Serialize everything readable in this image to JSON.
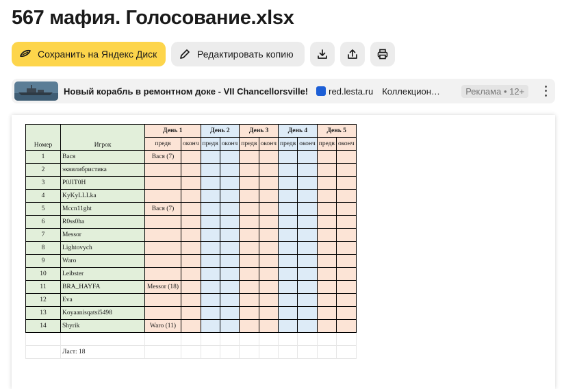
{
  "title": "567 мафия. Голосование.xlsx",
  "toolbar": {
    "save_label": "Сохранить на Яндекс Диск",
    "edit_label": "Редактировать копию",
    "download_icon": "download-icon",
    "share_icon": "share-icon",
    "print_icon": "print-icon"
  },
  "ad": {
    "title": "Новый корабль в ремонтном доке - VII Chancellorsville!",
    "domain": "red.lesta.ru",
    "text": "Коллекцион…",
    "badge": "Реклама • 12+"
  },
  "colors": {
    "accent": "#fdd54b",
    "green": "#e2efda",
    "orange": "#fce4d6",
    "blue": "#ddebf7"
  },
  "sheet": {
    "header": {
      "number": "Номер",
      "player": "Игрок",
      "days": [
        "День 1",
        "День 2",
        "День 3",
        "День 4",
        "День 5"
      ],
      "pre": "предв",
      "final": "оконч"
    },
    "rows": [
      {
        "num": "1",
        "player": "Вася",
        "vote": "Вася (7)"
      },
      {
        "num": "2",
        "player": "эквилибристика",
        "vote": ""
      },
      {
        "num": "3",
        "player": "P0JIT0H",
        "vote": ""
      },
      {
        "num": "4",
        "player": "KyKyLLLka",
        "vote": ""
      },
      {
        "num": "5",
        "player": "Mccn11ght",
        "vote": "Вася (7)"
      },
      {
        "num": "6",
        "player": "R0ss0ha",
        "vote": ""
      },
      {
        "num": "7",
        "player": "Messor",
        "vote": ""
      },
      {
        "num": "8",
        "player": "Lightovych",
        "vote": ""
      },
      {
        "num": "9",
        "player": "Waro",
        "vote": ""
      },
      {
        "num": "10",
        "player": "Leibster",
        "vote": ""
      },
      {
        "num": "11",
        "player": "BRA_HAYFA",
        "vote": "Messor (18)"
      },
      {
        "num": "12",
        "player": "Eva",
        "vote": ""
      },
      {
        "num": "13",
        "player": "Koyaanisqatsi5498",
        "vote": ""
      },
      {
        "num": "14",
        "player": "Shyrik",
        "vote": "Waro (11)"
      }
    ],
    "footer": "Ласт: 18"
  }
}
